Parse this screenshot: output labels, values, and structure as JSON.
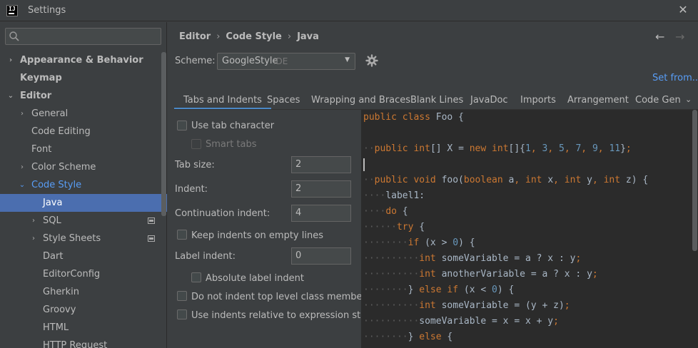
{
  "window": {
    "title": "Settings",
    "close_glyph": "✕"
  },
  "search": {
    "placeholder": "",
    "icon": "search-icon"
  },
  "tree": [
    {
      "label": "Appearance & Behavior",
      "arrow": "›",
      "level": 0,
      "bold": true
    },
    {
      "label": "Keymap",
      "arrow": "",
      "level": 0,
      "bold": true
    },
    {
      "label": "Editor",
      "arrow": "⌄",
      "level": 0,
      "bold": true
    },
    {
      "label": "General",
      "arrow": "›",
      "level": 1
    },
    {
      "label": "Code Editing",
      "arrow": "",
      "level": 1
    },
    {
      "label": "Font",
      "arrow": "",
      "level": 1
    },
    {
      "label": "Color Scheme",
      "arrow": "›",
      "level": 1
    },
    {
      "label": "Code Style",
      "arrow": "⌄",
      "level": 1,
      "blue": true
    },
    {
      "label": "Java",
      "arrow": "",
      "level": 2,
      "selected": true
    },
    {
      "label": "SQL",
      "arrow": "›",
      "level": 2,
      "scope": true
    },
    {
      "label": "Style Sheets",
      "arrow": "›",
      "level": 2,
      "scope": true
    },
    {
      "label": "Dart",
      "arrow": "",
      "level": 2
    },
    {
      "label": "EditorConfig",
      "arrow": "",
      "level": 2
    },
    {
      "label": "Gherkin",
      "arrow": "",
      "level": 2
    },
    {
      "label": "Groovy",
      "arrow": "",
      "level": 2
    },
    {
      "label": "HTML",
      "arrow": "",
      "level": 2
    },
    {
      "label": "HTTP Request",
      "arrow": "",
      "level": 2
    }
  ],
  "breadcrumb": {
    "a": "Editor",
    "b": "Code Style",
    "c": "Java",
    "sep": "›"
  },
  "nav": {
    "back": "←",
    "forward": "→"
  },
  "scheme": {
    "label": "Scheme:",
    "value": "GoogleStyle",
    "scope": "IDE",
    "arrow": "▼"
  },
  "set_from": "Set from...",
  "tabs": [
    {
      "label": "Tabs and Indents",
      "active": true
    },
    {
      "label": "Spaces"
    },
    {
      "label": "Wrapping and Braces"
    },
    {
      "label": "Blank Lines"
    },
    {
      "label": "JavaDoc"
    },
    {
      "label": "Imports"
    },
    {
      "label": "Arrangement"
    },
    {
      "label": "Code Gen"
    }
  ],
  "tabs_more": "⌄",
  "options": {
    "use_tab_character": "Use tab character",
    "smart_tabs": "Smart tabs",
    "tab_size_label": "Tab size:",
    "tab_size": "2",
    "indent_label": "Indent:",
    "indent": "2",
    "continuation_label": "Continuation indent:",
    "continuation": "4",
    "keep_indents": "Keep indents on empty lines",
    "label_indent_label": "Label indent:",
    "label_indent": "0",
    "absolute_label": "Absolute label indent",
    "no_indent_top": "Do not indent top level class members",
    "relative_expr": "Use indents relative to expression start"
  },
  "code": [
    [
      [
        "kw",
        "public class "
      ],
      [
        "id",
        "Foo {"
      ]
    ],
    [],
    [
      [
        "ws",
        "··"
      ],
      [
        "kw",
        "public int"
      ],
      [
        "id",
        "[] X = "
      ],
      [
        "kw",
        "new int"
      ],
      [
        "id",
        "[]{"
      ],
      [
        "num",
        "1"
      ],
      [
        "kw",
        ", "
      ],
      [
        "num",
        "3"
      ],
      [
        "kw",
        ", "
      ],
      [
        "num",
        "5"
      ],
      [
        "kw",
        ", "
      ],
      [
        "num",
        "7"
      ],
      [
        "kw",
        ", "
      ],
      [
        "num",
        "9"
      ],
      [
        "kw",
        ", "
      ],
      [
        "num",
        "11"
      ],
      [
        "id",
        "}"
      ],
      [
        "kw",
        ";"
      ]
    ],
    [],
    [
      [
        "ws",
        "··"
      ],
      [
        "kw",
        "public void "
      ],
      [
        "id",
        "foo("
      ],
      [
        "kw",
        "boolean "
      ],
      [
        "id",
        "a"
      ],
      [
        "kw",
        ", int "
      ],
      [
        "id",
        "x"
      ],
      [
        "kw",
        ", int "
      ],
      [
        "id",
        "y"
      ],
      [
        "kw",
        ", int "
      ],
      [
        "id",
        "z) {"
      ]
    ],
    [
      [
        "ws",
        "····"
      ],
      [
        "id",
        "label1:"
      ]
    ],
    [
      [
        "ws",
        "····"
      ],
      [
        "kw",
        "do "
      ],
      [
        "id",
        "{"
      ]
    ],
    [
      [
        "ws",
        "······"
      ],
      [
        "kw",
        "try "
      ],
      [
        "id",
        "{"
      ]
    ],
    [
      [
        "ws",
        "········"
      ],
      [
        "kw",
        "if "
      ],
      [
        "id",
        "(x > "
      ],
      [
        "num",
        "0"
      ],
      [
        "id",
        ") {"
      ]
    ],
    [
      [
        "ws",
        "··········"
      ],
      [
        "kw",
        "int "
      ],
      [
        "id",
        "someVariable = a ? x : y"
      ],
      [
        "kw",
        ";"
      ]
    ],
    [
      [
        "ws",
        "··········"
      ],
      [
        "kw",
        "int "
      ],
      [
        "id",
        "anotherVariable = a ? x : y"
      ],
      [
        "kw",
        ";"
      ]
    ],
    [
      [
        "ws",
        "········"
      ],
      [
        "id",
        "} "
      ],
      [
        "kw",
        "else if "
      ],
      [
        "id",
        "(x < "
      ],
      [
        "num",
        "0"
      ],
      [
        "id",
        ") {"
      ]
    ],
    [
      [
        "ws",
        "··········"
      ],
      [
        "kw",
        "int "
      ],
      [
        "id",
        "someVariable = (y + z)"
      ],
      [
        "kw",
        ";"
      ]
    ],
    [
      [
        "ws",
        "··········"
      ],
      [
        "id",
        "someVariable = x = x + y"
      ],
      [
        "kw",
        ";"
      ]
    ],
    [
      [
        "ws",
        "········"
      ],
      [
        "id",
        "} "
      ],
      [
        "kw",
        "else "
      ],
      [
        "id",
        "{"
      ]
    ]
  ]
}
